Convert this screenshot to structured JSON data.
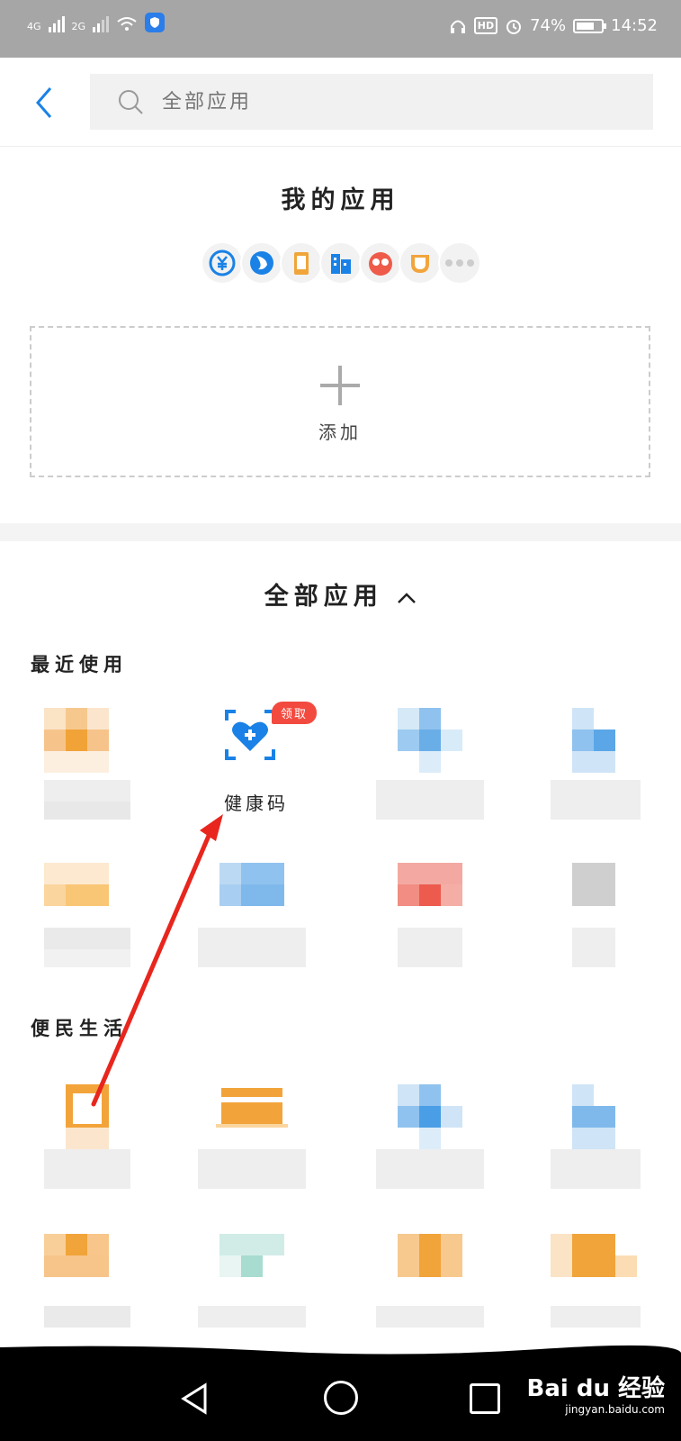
{
  "status_bar": {
    "signal1_label": "4G",
    "signal2_label": "2G",
    "battery_percent": "74%",
    "time": "14:52",
    "hd_label": "HD",
    "battery_level": 0.74
  },
  "header": {
    "search_placeholder": "全部应用"
  },
  "my_apps": {
    "title": "我的应用",
    "add_label": "添加",
    "icons": [
      "yuan-icon",
      "fish-icon",
      "phone-icon",
      "building-icon",
      "glasses-face-icon",
      "cup-icon",
      "more-icon"
    ]
  },
  "all_apps": {
    "title": "全部应用",
    "recent_title": "最近使用",
    "life_title": "便民生活",
    "health_app": {
      "label": "健康码",
      "badge": "领取"
    }
  },
  "colors": {
    "accent_blue": "#1a82e6",
    "badge_red": "#f34a3f",
    "arrow_red": "#e8261d"
  },
  "watermark": {
    "brand": "Bai du 经验",
    "url": "jingyan.baidu.com"
  }
}
